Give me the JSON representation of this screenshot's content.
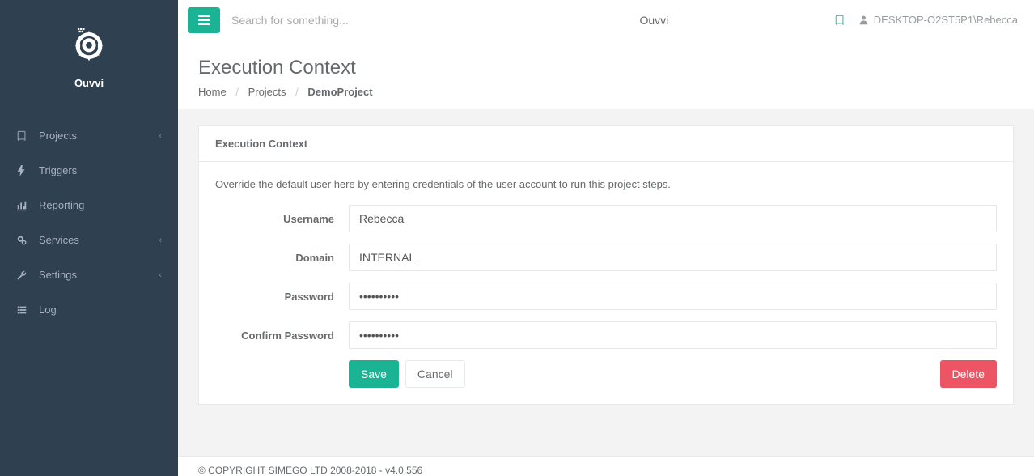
{
  "brand": {
    "name": "Ouvvi"
  },
  "sidebar": {
    "items": [
      {
        "label": "Projects",
        "icon": "book-icon",
        "has_children": true
      },
      {
        "label": "Triggers",
        "icon": "bolt-icon",
        "has_children": false
      },
      {
        "label": "Reporting",
        "icon": "chart-icon",
        "has_children": false
      },
      {
        "label": "Services",
        "icon": "gears-icon",
        "has_children": true
      },
      {
        "label": "Settings",
        "icon": "wrench-icon",
        "has_children": true
      },
      {
        "label": "Log",
        "icon": "list-icon",
        "has_children": false
      }
    ]
  },
  "topbar": {
    "search_placeholder": "Search for something...",
    "app_name": "Ouvvi",
    "user_display": "DESKTOP-O2ST5P1\\Rebecca"
  },
  "page": {
    "title": "Execution Context",
    "breadcrumb": {
      "home": "Home",
      "projects": "Projects",
      "current": "DemoProject"
    }
  },
  "card": {
    "title": "Execution Context",
    "help": "Override the default user here by entering credentials of the user account to run this project steps.",
    "fields": {
      "username_label": "Username",
      "username_value": "Rebecca",
      "domain_label": "Domain",
      "domain_value": "INTERNAL",
      "password_label": "Password",
      "password_value": "••••••••••",
      "confirm_label": "Confirm Password",
      "confirm_value": "••••••••••"
    },
    "buttons": {
      "save": "Save",
      "cancel": "Cancel",
      "delete": "Delete"
    }
  },
  "footer": {
    "text": "© COPYRIGHT SIMEGO LTD 2008-2018 - v4.0.556"
  }
}
